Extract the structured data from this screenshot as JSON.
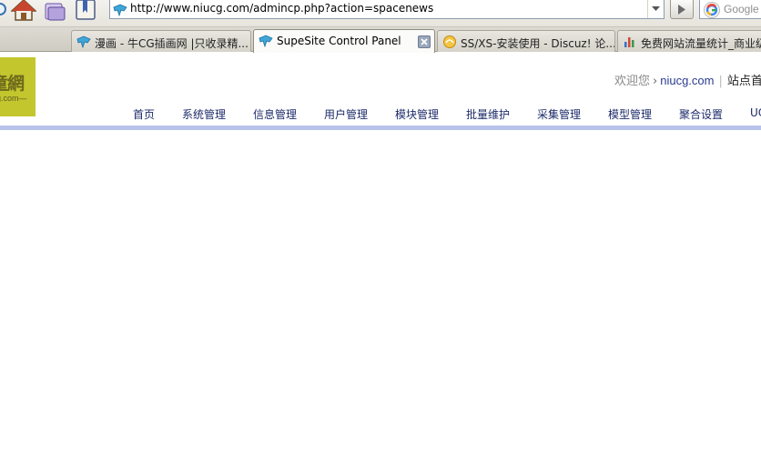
{
  "browser": {
    "url": "http://www.niucg.com/admincp.php?action=spacenews",
    "search_placeholder": "Google",
    "tabs": [
      {
        "title": "漫画 - 牛CG插画网 |只收录精..."
      },
      {
        "title": "SupeSite Control Panel"
      },
      {
        "title": "SS/XS-安装使用 - Discuz! 论..."
      },
      {
        "title": "免费网站流量统计_商业级"
      }
    ]
  },
  "page": {
    "logo_text": "童網",
    "logo_sub": "g.com—",
    "user_bar": {
      "welcome": "欢迎您",
      "username": "niucg.com",
      "home_link": "站点首页"
    },
    "nav": [
      {
        "label": "首页"
      },
      {
        "label": "系统管理"
      },
      {
        "label": "信息管理"
      },
      {
        "label": "用户管理"
      },
      {
        "label": "模块管理"
      },
      {
        "label": "批量维护"
      },
      {
        "label": "采集管理"
      },
      {
        "label": "模型管理"
      },
      {
        "label": "聚合设置"
      },
      {
        "label": "UC"
      }
    ]
  },
  "colors": {
    "nav_text": "#1d2b69",
    "nav_rule": "#b8c3ea",
    "logo_bg": "#c3c62d",
    "username": "#2b3b8f"
  },
  "icons": [
    "search-icon",
    "home-icon",
    "history-icon",
    "bookmarks-icon",
    "dropdown-arrow-icon",
    "go-arrow-icon",
    "google-icon",
    "close-tab-icon",
    "chart-icon",
    "forum-icon"
  ]
}
